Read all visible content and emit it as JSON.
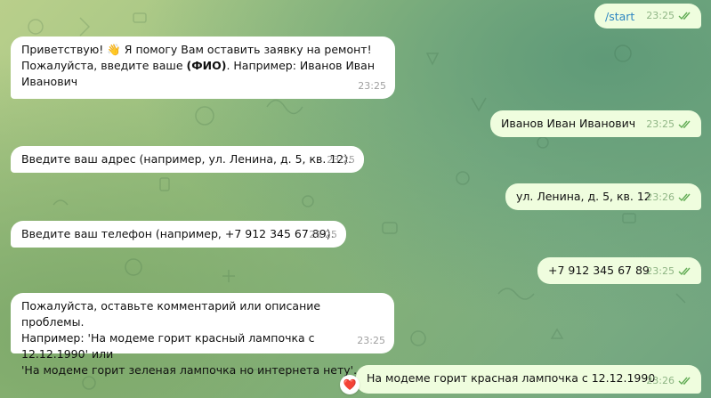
{
  "chat": {
    "messages": [
      {
        "dir": "out",
        "text": "/start",
        "time": "23:25",
        "is_command": true
      },
      {
        "dir": "in",
        "text_pre": "Приветствую! ",
        "emoji": "👋",
        "text_post": " Я помогу Вам оставить заявку на ремонт!\nПожалуйста, введите ваше ",
        "bold": "(ФИО)",
        "text_end": ". Например: Иванов Иван\nИванович",
        "time": "23:25"
      },
      {
        "dir": "out",
        "text": "Иванов Иван Иванович",
        "time": "23:25"
      },
      {
        "dir": "in",
        "text": "Введите ваш адрес (например, ул. Ленина, д. 5, кв. 12).",
        "time": "23:25"
      },
      {
        "dir": "out",
        "text": "ул. Ленина, д. 5, кв. 12",
        "time": "23:26"
      },
      {
        "dir": "in",
        "text": "Введите ваш телефон (например, +7 912 345 67 89).",
        "time": "23:25"
      },
      {
        "dir": "out",
        "text": "+7 912 345 67 89",
        "time": "23:25"
      },
      {
        "dir": "in",
        "text": "Пожалуйста, оставьте комментарий или описание проблемы.\nНапример: 'На модеме горит красный лампочка с 12.12.1990' или\n'На модеме горит зеленая лампочка но интернета нету'.",
        "time": "23:25"
      },
      {
        "dir": "out",
        "text": "На модеме горит красная лампочка с 12.12.1990",
        "time": "23:26",
        "reaction": "❤️"
      }
    ]
  },
  "colors": {
    "incoming": "#ffffff",
    "outgoing": "#effdde",
    "check": "#62ac55",
    "command_link": "#2f87c2"
  },
  "icons": {
    "read_status": "double-check-icon",
    "reaction": "heart-icon"
  }
}
